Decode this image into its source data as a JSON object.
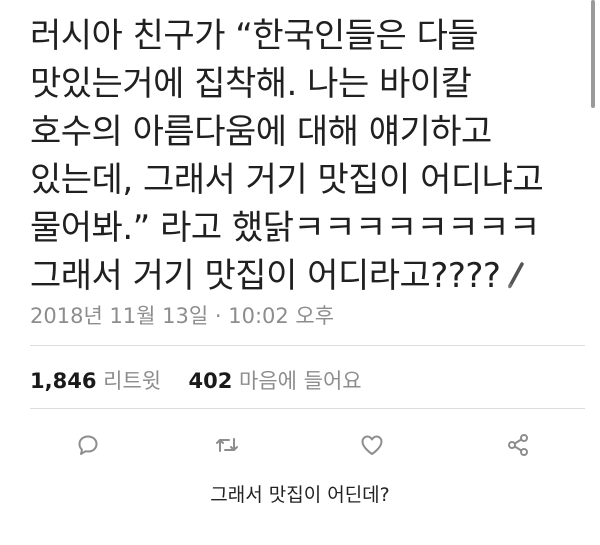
{
  "tweet": {
    "lines": [
      "러시아 친구가 “한국인들은 다들",
      "맛있는거에 집착해. 나는 바이칼",
      "호수의 아름다움에 대해 얘기하고",
      "있는데, 그래서 거기 맛집이 어디냐고",
      "물어봐.” 라고 했닭ㅋㅋㅋㅋㅋㅋㅋㅋ",
      "그래서 거기 맛집이 어디라고????"
    ],
    "timestamp": "2018년 11월 13일 · 10:02 오후"
  },
  "stats": {
    "retweet_count": "1,846",
    "retweet_label": "리트윗",
    "like_count": "402",
    "like_label": "마음에 들어요"
  },
  "actions": {
    "icons": [
      "reply-icon",
      "retweet-icon",
      "like-icon",
      "share-icon"
    ],
    "icon_color": "#8d8d8d"
  },
  "caption": "그래서 맛집이 어딘데?"
}
